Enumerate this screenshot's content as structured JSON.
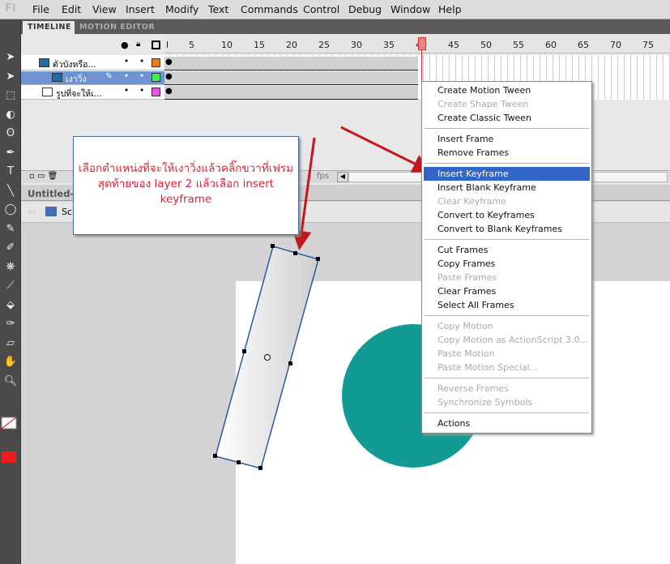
{
  "app": {
    "logo": "Fl"
  },
  "menu": [
    "File",
    "Edit",
    "View",
    "Insert",
    "Modify",
    "Text",
    "Commands",
    "Control",
    "Debug",
    "Window",
    "Help"
  ],
  "timeline": {
    "tabs": [
      "TIMELINE",
      "MOTION EDITOR"
    ],
    "ruler": [
      "l",
      "5",
      "10",
      "15",
      "20",
      "25",
      "30",
      "35",
      "40",
      "45",
      "50",
      "55",
      "60",
      "65",
      "70",
      "75"
    ],
    "layers": [
      {
        "name": "ตัวบังหรือ...",
        "color": "#f07d0e"
      },
      {
        "name": "เงาวิ่ง",
        "color": "#3ef04a",
        "selected": true
      },
      {
        "name": "รูปที่จะให้เ...",
        "color": "#f050f0"
      }
    ],
    "playhead_frame": 40,
    "fps_fragment": "fps"
  },
  "document": {
    "tab": "Untitled-2",
    "scene": "Sc"
  },
  "callout": {
    "text": "เลือกตำแหน่งที่จะให้เงาวิ่งแล้วคลิ๊กขวาที่เฟรมสุดท้ายของ layer 2 แล้วเลือก insert keyframe"
  },
  "stage": {
    "circle_color": "#119b94"
  },
  "context_menu": {
    "groups": [
      [
        {
          "label": "Create Motion Tween"
        },
        {
          "label": "Create Shape Tween",
          "disabled": true
        },
        {
          "label": "Create Classic Tween"
        }
      ],
      [
        {
          "label": "Insert Frame"
        },
        {
          "label": "Remove Frames"
        }
      ],
      [
        {
          "label": "Insert Keyframe",
          "selected": true
        },
        {
          "label": "Insert Blank Keyframe"
        },
        {
          "label": "Clear Keyframe",
          "disabled": true
        },
        {
          "label": "Convert to Keyframes"
        },
        {
          "label": "Convert to Blank Keyframes"
        }
      ],
      [
        {
          "label": "Cut Frames"
        },
        {
          "label": "Copy Frames"
        },
        {
          "label": "Paste Frames",
          "disabled": true
        },
        {
          "label": "Clear Frames"
        },
        {
          "label": "Select All Frames"
        }
      ],
      [
        {
          "label": "Copy Motion",
          "disabled": true
        },
        {
          "label": "Copy Motion as ActionScript 3.0...",
          "disabled": true
        },
        {
          "label": "Paste Motion",
          "disabled": true
        },
        {
          "label": "Paste Motion Special...",
          "disabled": true
        }
      ],
      [
        {
          "label": "Reverse Frames",
          "disabled": true
        },
        {
          "label": "Synchronize Symbols",
          "disabled": true
        }
      ],
      [
        {
          "label": "Actions"
        }
      ]
    ]
  },
  "colors": {
    "accent": "#3166c7",
    "annotation": "#d8243a",
    "fill": "#ee1c1c"
  }
}
